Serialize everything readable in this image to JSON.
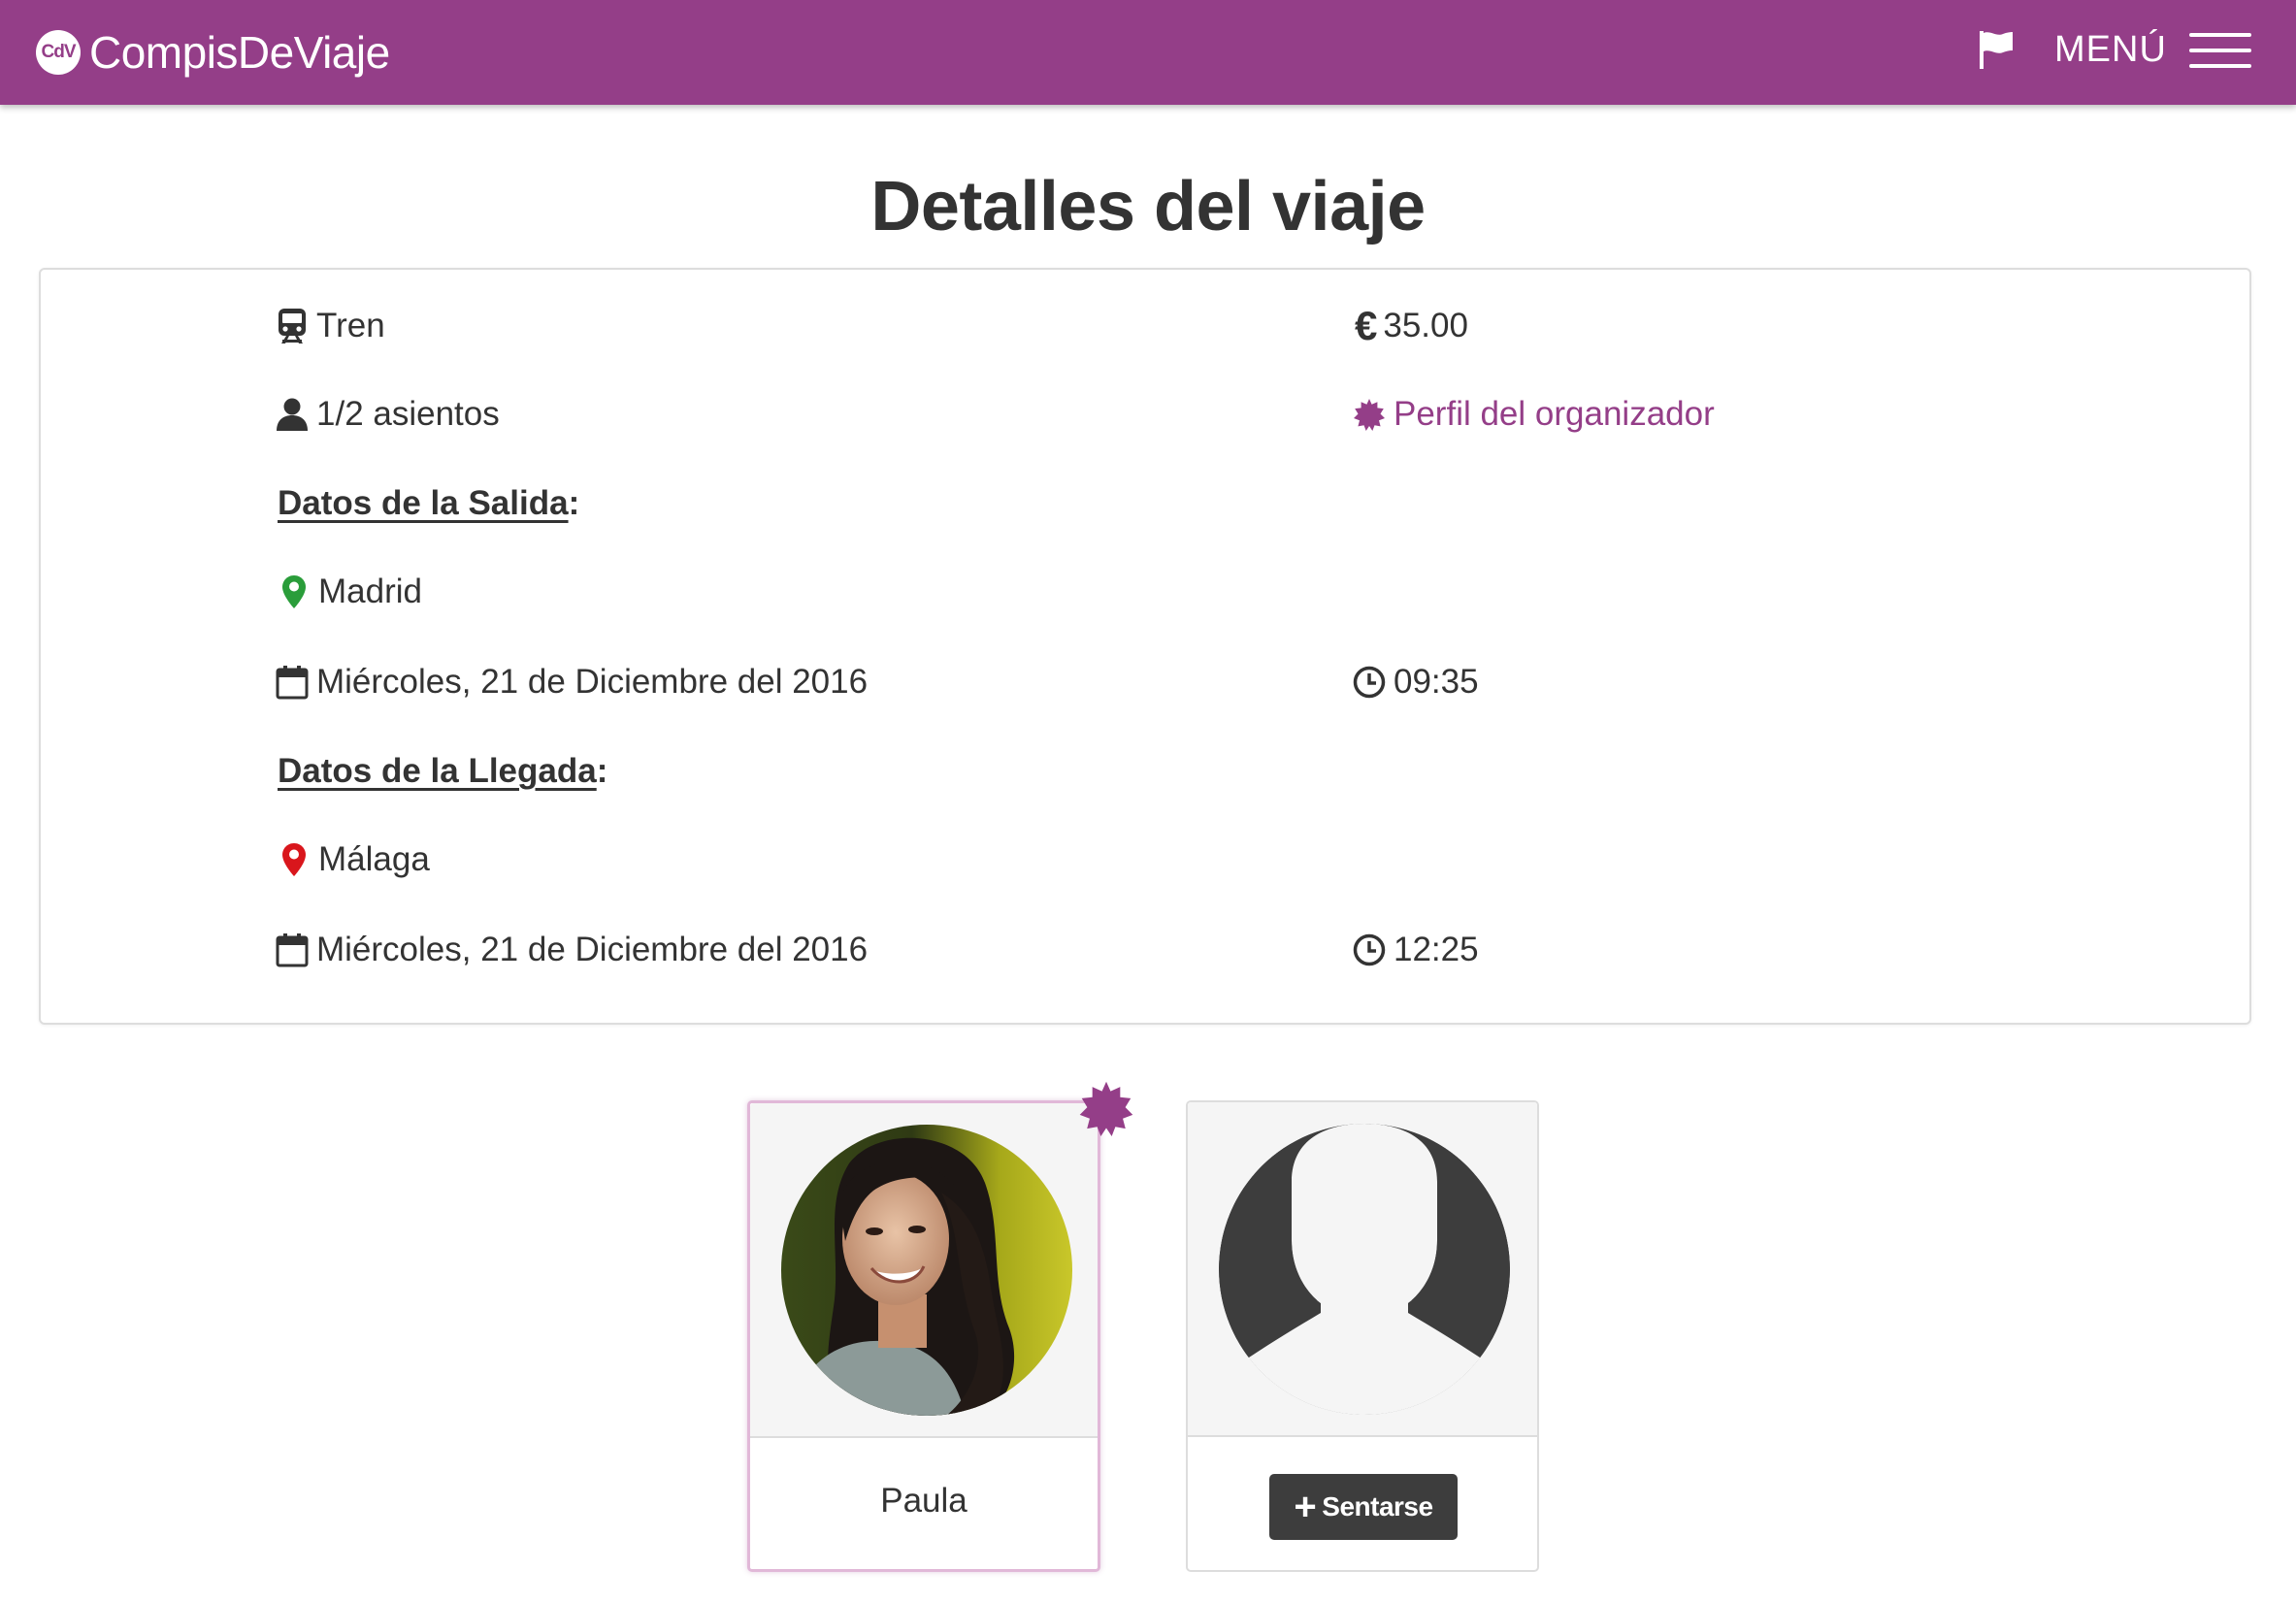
{
  "navbar": {
    "logo_text": "CdV",
    "brand": "CompisDeViaje",
    "menu_label": "MENÚ",
    "icons": [
      "flag-icon",
      "hamburger-icon"
    ]
  },
  "page": {
    "title": "Detalles del viaje"
  },
  "trip": {
    "transport": "Tren",
    "price": "35.00",
    "currency_symbol": "€",
    "seats": "1/2 asientos",
    "organizer_link": "Perfil del organizador",
    "departure": {
      "heading": "Datos de la Salida",
      "city": "Madrid",
      "date": "Miércoles, 21 de Diciembre del 2016",
      "time": "09:35"
    },
    "arrival": {
      "heading": "Datos de la Llegada",
      "city": "Málaga",
      "date": "Miércoles, 21 de Diciembre del 2016",
      "time": "12:25"
    }
  },
  "passengers": [
    {
      "name": "Paula",
      "role": "organizer"
    },
    {
      "button_label": "Sentarse",
      "role": "empty-seat"
    }
  ],
  "colors": {
    "brand": "#943e88",
    "text": "#333333",
    "departure_pin": "#2a9d3a",
    "arrival_pin": "#d9161c",
    "button": "#3d3d3d"
  }
}
